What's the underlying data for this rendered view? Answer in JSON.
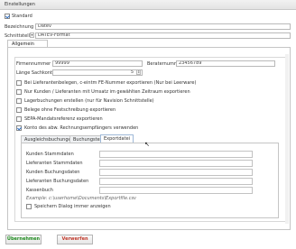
{
  "window": {
    "title": "Einstellungen"
  },
  "standard": {
    "label": "Standard",
    "checked": true
  },
  "bezeichnung": {
    "label": "Bezeichnung",
    "value": "Datev"
  },
  "schnittstelle": {
    "label": "Schnittstelle",
    "value": "DATEV-Format"
  },
  "tabs": {
    "allgemein": "Allgemein"
  },
  "firmennummer": {
    "label": "Firmennummer",
    "value": "99999"
  },
  "beraternummer": {
    "label": "Beraternummer",
    "value": "23456789"
  },
  "sachkonto": {
    "label": "Länge Sachkonto",
    "value": "5"
  },
  "options": [
    {
      "label": "Bei Lieferantenbelegen, c-eintm FE-Nummer exportieren (Nur bei Leerware)",
      "checked": false
    },
    {
      "label": "Nur Kunden / Lieferanten mit Umsatz im gewählten Zeitraum exportieren",
      "checked": false
    },
    {
      "label": "Lagerbuchungen erstellen (nur für Navision Schnittstelle)",
      "checked": false
    },
    {
      "label": "Belege ohne Festschreibung exportieren",
      "checked": false
    },
    {
      "label": "SEPA-Mandatsreferenz exportieren",
      "checked": false
    },
    {
      "label": "Konto des abw. Rechnungsempfängers verwenden",
      "checked": true
    }
  ],
  "subtabs": [
    "Ausgleichsbuchungen",
    "Buchungstext",
    "Exportdatei"
  ],
  "export_fields": [
    "Kunden Stammdaten",
    "Lieferanten Stammdaten",
    "Kunden Buchungsdaten",
    "Lieferanten Buchungsdaten",
    "Kassenbuch"
  ],
  "example_path": "Example: c:\\userhome\\Documents\\Exportfile.csv",
  "save_dialog": {
    "label": "Speichern Dialog immer anzeigen",
    "checked": false
  },
  "buttons": {
    "ok": "Übernehmen",
    "cancel": "Verwerfen"
  }
}
